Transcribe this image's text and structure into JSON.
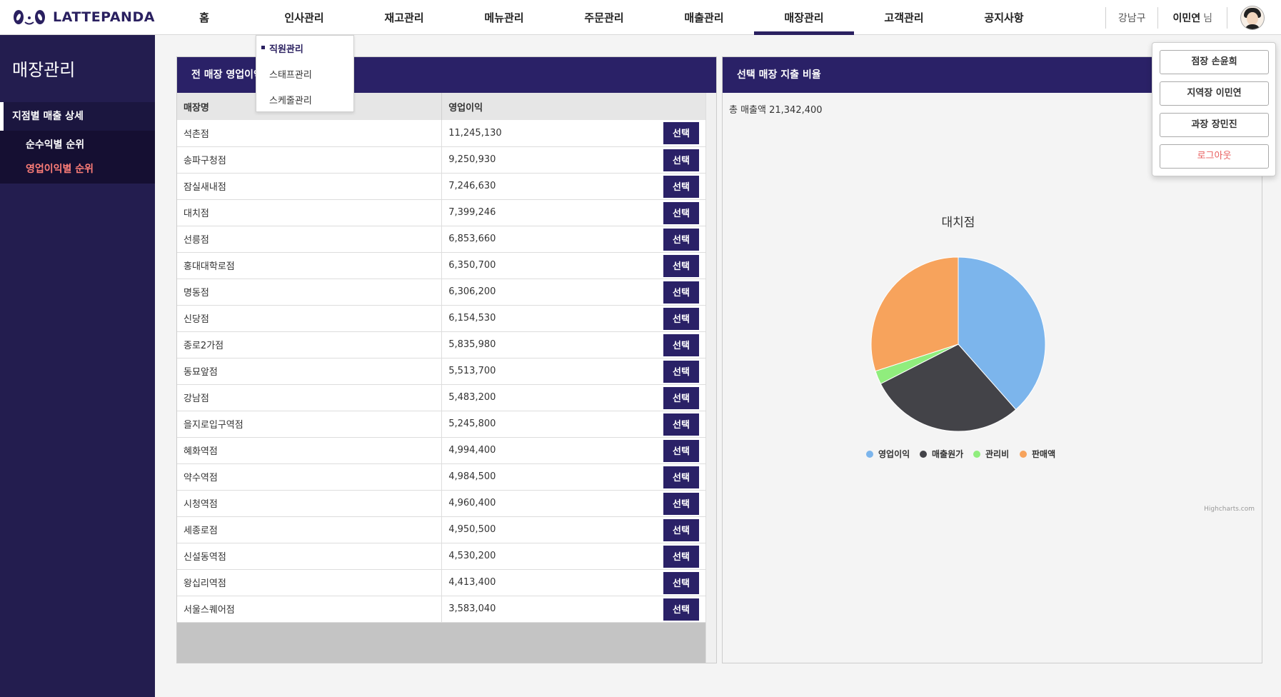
{
  "brand": {
    "name": "LATTEPANDA"
  },
  "nav": {
    "items": [
      "홈",
      "인사관리",
      "재고관리",
      "메뉴관리",
      "주문관리",
      "매출관리",
      "매장관리",
      "고객관리",
      "공지사항"
    ],
    "active": "매장관리"
  },
  "header": {
    "region": "강남구",
    "user_name": "이민연",
    "user_suffix": "님"
  },
  "hr_submenu": {
    "items": [
      "직원관리",
      "스태프관리",
      "스케줄관리"
    ],
    "active": "직원관리"
  },
  "user_menu": {
    "items": [
      "점장 손윤희",
      "지역장 이민연",
      "과장 장민진"
    ],
    "logout": "로그아웃"
  },
  "sidebar": {
    "title": "매장관리",
    "section": "지점별 매출 상세",
    "items": [
      "순수익별 순위",
      "영업이익별 순위"
    ],
    "active": "영업이익별 순위"
  },
  "left_panel": {
    "title": "전 매장 영업이익",
    "columns": [
      "매장명",
      "영업이익"
    ],
    "select_label": "선택",
    "rows": [
      [
        "석촌점",
        "11,245,130"
      ],
      [
        "송파구청점",
        "9,250,930"
      ],
      [
        "잠실새내점",
        "7,246,630"
      ],
      [
        "대치점",
        "7,399,246"
      ],
      [
        "선릉점",
        "6,853,660"
      ],
      [
        "홍대대학로점",
        "6,350,700"
      ],
      [
        "명동점",
        "6,306,200"
      ],
      [
        "신당점",
        "6,154,530"
      ],
      [
        "종로2가점",
        "5,835,980"
      ],
      [
        "동묘앞점",
        "5,513,700"
      ],
      [
        "강남점",
        "5,483,200"
      ],
      [
        "을지로입구역점",
        "5,245,800"
      ],
      [
        "혜화역점",
        "4,994,400"
      ],
      [
        "약수역점",
        "4,984,500"
      ],
      [
        "시청역점",
        "4,960,400"
      ],
      [
        "세종로점",
        "4,950,500"
      ],
      [
        "신설동역점",
        "4,530,200"
      ],
      [
        "왕십리역점",
        "4,413,400"
      ],
      [
        "서울스퀘어점",
        "3,583,040"
      ]
    ]
  },
  "right_panel": {
    "title": "선택 매장 지출 비율",
    "total_label": "총 매출액 21,342,400",
    "credit": "Highcharts.com"
  },
  "chart_data": {
    "type": "pie",
    "title": "대치점",
    "series": [
      {
        "name": "영업이익",
        "value": 38.5,
        "color": "#7cb5ec"
      },
      {
        "name": "매출원가",
        "value": 29.0,
        "color": "#434348"
      },
      {
        "name": "관리비",
        "value": 2.5,
        "color": "#90ed7d"
      },
      {
        "name": "판매액",
        "value": 30.0,
        "color": "#f7a35c"
      }
    ],
    "legend": "bottom-center"
  }
}
